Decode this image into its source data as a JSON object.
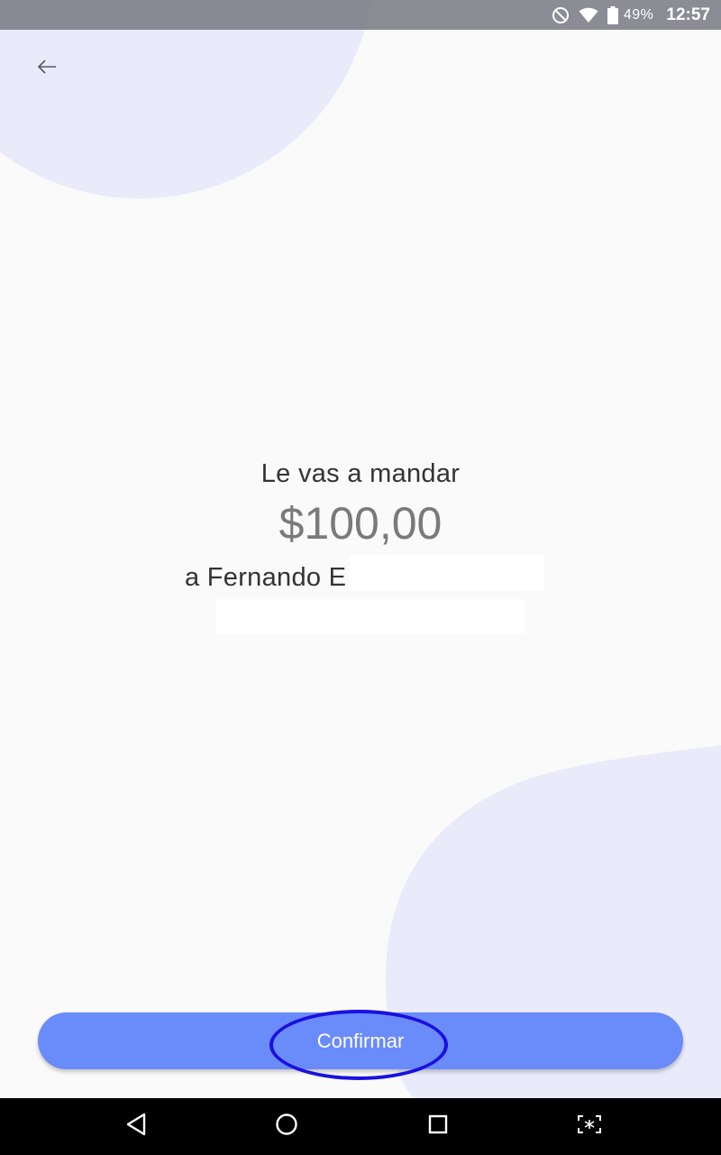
{
  "status_bar": {
    "battery_percent": "49%",
    "time": "12:57",
    "icons": [
      "do-not-disturb-icon",
      "wifi-icon",
      "battery-icon"
    ]
  },
  "header": {
    "back_icon": "arrow-left-icon"
  },
  "transfer": {
    "heading": "Le vas a mandar",
    "amount": "$100,00",
    "recipient": "a Fernando E"
  },
  "actions": {
    "confirm_label": "Confirmar"
  },
  "nav_bar": {
    "icons": [
      "back-triangle-icon",
      "home-circle-icon",
      "recents-square-icon",
      "screenshot-icon"
    ]
  },
  "colors": {
    "background": "#fafafa",
    "blob": "#e9eafa",
    "primary_button": "#6a8bfa",
    "highlight": "#1a10e0",
    "text_dark": "#333333",
    "text_amount": "#7a7a7a"
  }
}
